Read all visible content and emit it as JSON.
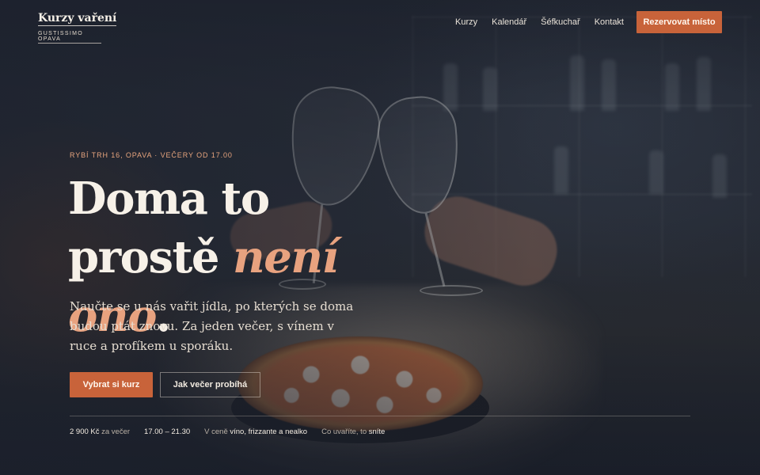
{
  "brand": {
    "name": "Kurzy vaření",
    "subtitle": "GUSTISSIMO OPAVA"
  },
  "nav": {
    "links": [
      "Kurzy",
      "Kalendář",
      "Šéfkuchař",
      "Kontakt"
    ],
    "cta_label": "Rezervovat místo"
  },
  "hero": {
    "eyebrow": "RYBÍ TRH 16, OPAVA · VEČERY OD 17.00",
    "headline_line1": "Doma to",
    "headline_word": "prostě",
    "headline_accent": "není ono",
    "headline_end": ".",
    "lead": "Naučte se u nás vařit jídla, po kterých se doma budou ptát znovu. Za jeden večer, s vínem v ruce a profíkem u sporáku.",
    "primary_button": "Vybrat si kurz",
    "secondary_button": "Jak večer probíhá"
  },
  "facts": [
    {
      "strong": "2 900 Kč",
      "muted": " za večer",
      "order": "strong-first"
    },
    {
      "strong": "17.00 – 21.30",
      "muted": "",
      "order": "strong-first"
    },
    {
      "muted": "V ceně ",
      "strong": "víno, frizzante a nealko",
      "order": "muted-first"
    },
    {
      "muted": "Co uvaříte, to ",
      "strong": "sníte",
      "order": "muted-first"
    }
  ],
  "colors": {
    "accent": "#c8633a",
    "accent_text": "#e8a27f",
    "background": "#1d2230"
  }
}
